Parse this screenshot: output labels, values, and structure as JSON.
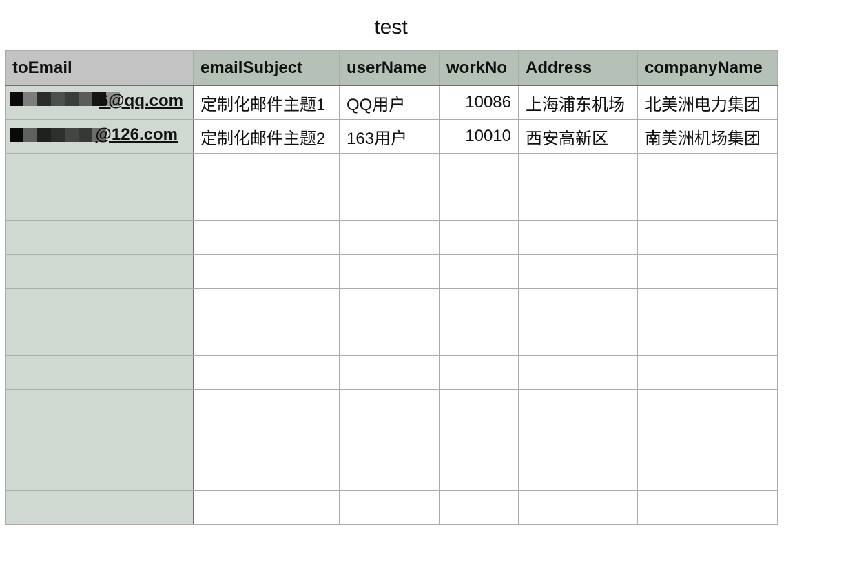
{
  "sheet": {
    "title": "test"
  },
  "table": {
    "headers": [
      "toEmail",
      "emailSubject",
      "userName",
      "workNo",
      "Address",
      "companyName"
    ],
    "rows": [
      {
        "toEmail": "6@qq.com",
        "emailSubject": "定制化邮件主题1",
        "userName": "QQ用户",
        "workNo": "10086",
        "Address": "上海浦东机场",
        "companyName": "北美洲电力集团"
      },
      {
        "toEmail": "@126.com",
        "emailSubject": "定制化邮件主题2",
        "userName": "163用户",
        "workNo": "10010",
        "Address": "西安高新区",
        "companyName": "南美洲机场集团"
      }
    ],
    "empty_row_count": 11
  },
  "colors": {
    "header_bg": "#b5c1b6",
    "first_header_bg": "#c2c3c2",
    "first_column_bg": "#cfd9d2",
    "grid_line": "#a9aca9"
  }
}
